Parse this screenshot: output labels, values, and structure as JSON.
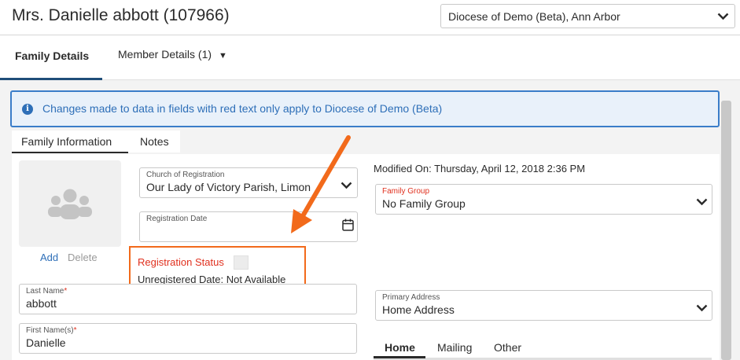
{
  "header": {
    "title": "Mrs. Danielle abbott (107966)",
    "diocese_select": "Diocese of Demo (Beta), Ann Arbor"
  },
  "tabs": {
    "family_details": "Family Details",
    "member_details": "Member Details (1)"
  },
  "banner": {
    "icon": "info-icon",
    "message": "Changes made to data in fields with red text only apply to Diocese of Demo (Beta)"
  },
  "subtabs": {
    "family_information": "Family Information",
    "notes": "Notes"
  },
  "photo": {
    "icon": "group-icon",
    "add": "Add",
    "delete": "Delete"
  },
  "church_of_registration": {
    "label": "Church of Registration",
    "value": "Our Lady of Victory Parish, Limon"
  },
  "registration_date": {
    "label": "Registration Date",
    "value": ""
  },
  "registration_status": {
    "label": "Registration Status",
    "unregistered_date": "Unregistered Date: Not Available"
  },
  "modified_on": "Modified On: Thursday, April 12, 2018 2:36 PM",
  "family_group": {
    "label": "Family Group",
    "value": "No Family Group"
  },
  "last_name": {
    "label": "Last Name",
    "required": "*",
    "value": "abbott"
  },
  "first_name": {
    "label": "First Name(s)",
    "required": "*",
    "value": "Danielle"
  },
  "primary_address": {
    "label": "Primary Address",
    "value": "Home Address"
  },
  "address_tabs": {
    "home": "Home",
    "mailing": "Mailing",
    "other": "Other"
  },
  "colors": {
    "accent_blue": "#2e6fb8",
    "required_red": "#e0301e",
    "highlight_orange": "#f26a1b"
  }
}
